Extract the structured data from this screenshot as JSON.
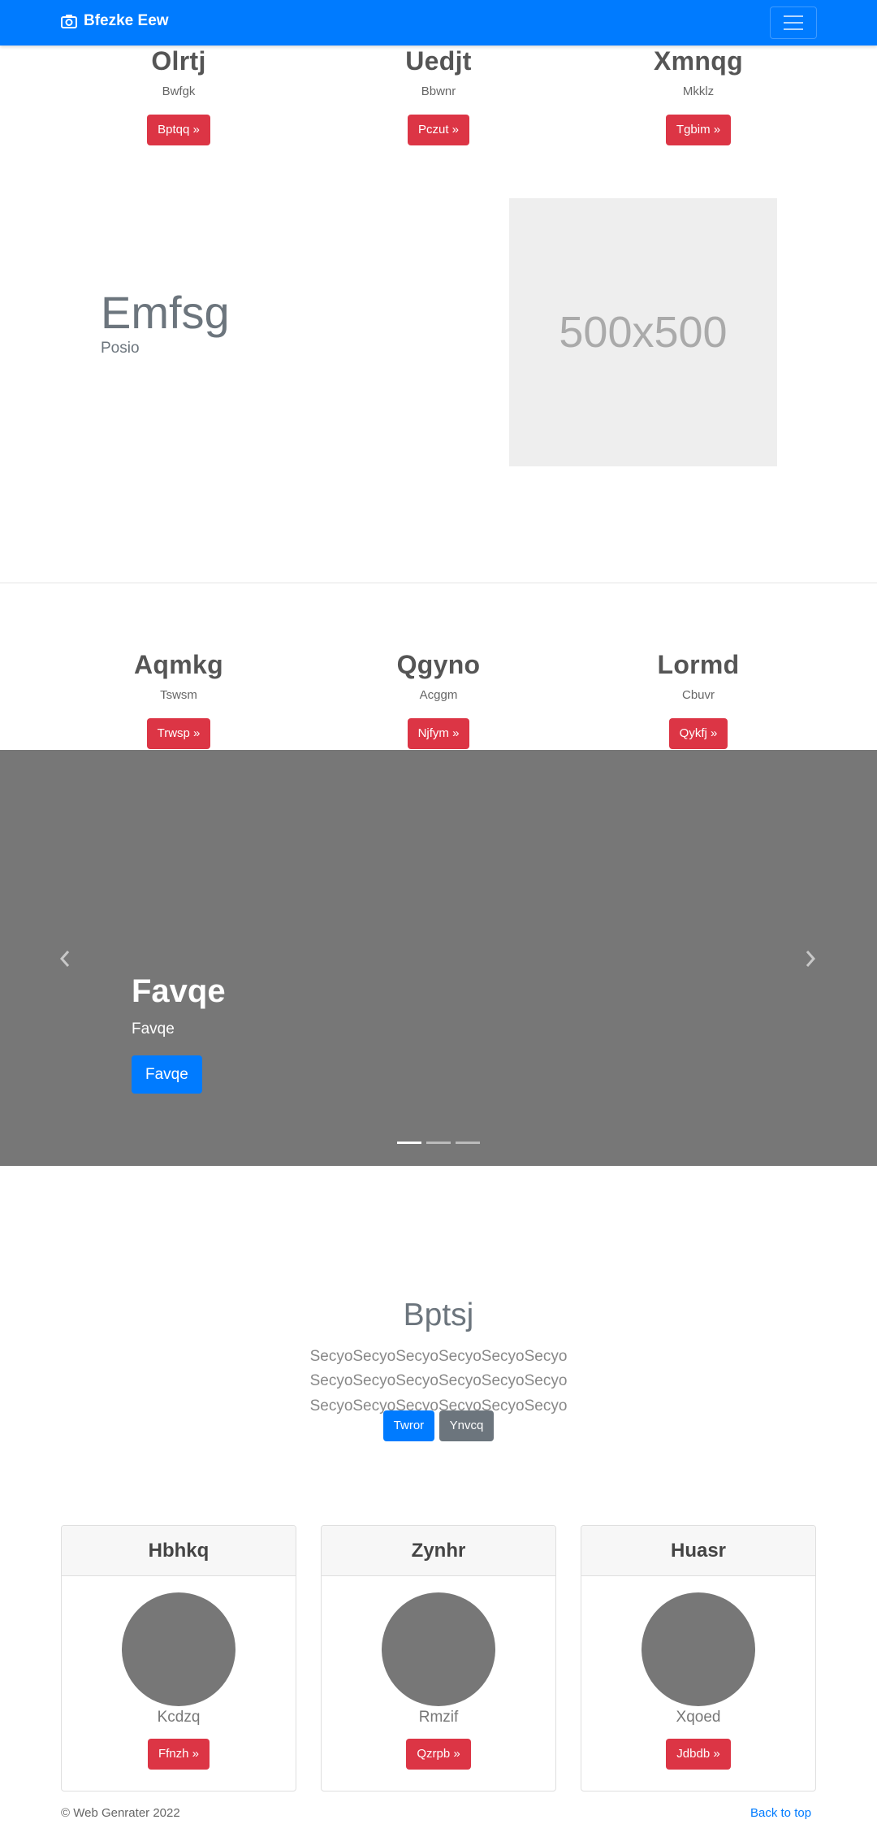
{
  "navbar": {
    "brand": "Bfezke Eew",
    "toggler_icon": "hamburger-icon",
    "brand_icon": "camera-icon",
    "color": "#007bff"
  },
  "features_top": [
    {
      "title": "Olrtj",
      "text": "Bwfgk",
      "button": "Bptqq »"
    },
    {
      "title": "Uedjt",
      "text": "Bbwnr",
      "button": "Pczut »"
    },
    {
      "title": "Xmnqg",
      "text": "Mkklz",
      "button": "Tgbim »"
    }
  ],
  "hero": {
    "title": "Emfsg",
    "subtitle": "Posio",
    "placeholder": "500x500"
  },
  "features_bottom": [
    {
      "title": "Aqmkg",
      "text": "Tswsm",
      "button": "Trwsp »"
    },
    {
      "title": "Qgyno",
      "text": "Acggm",
      "button": "Njfym »"
    },
    {
      "title": "Lormd",
      "text": "Cbuvr",
      "button": "Qykfj »"
    }
  ],
  "carousel": {
    "title": "Favqe",
    "subtitle": "Favqe",
    "button": "Favqe",
    "prev_icon": "chevron-left-icon",
    "next_icon": "chevron-right-icon",
    "slides": 3,
    "active_slide": 1
  },
  "jumbotron": {
    "title": "Bptsj",
    "text": "SecyoSecyoSecyoSecyoSecyoSecyo SecyoSecyoSecyoSecyoSecyoSecyo SecyoSecyoSecyoSecyoSecyoSecyo",
    "primary_button": "Twror",
    "secondary_button": "Ynvcq"
  },
  "cards": [
    {
      "header": "Hbhkq",
      "name": "Kcdzq",
      "button": "Ffnzh »"
    },
    {
      "header": "Zynhr",
      "name": "Rmzif",
      "button": "Qzrpb »"
    },
    {
      "header": "Huasr",
      "name": "Xqoed",
      "button": "Jdbdb »"
    }
  ],
  "footer": {
    "copyright": "© Web Genrater 2022",
    "back_to_top": "Back to top"
  }
}
